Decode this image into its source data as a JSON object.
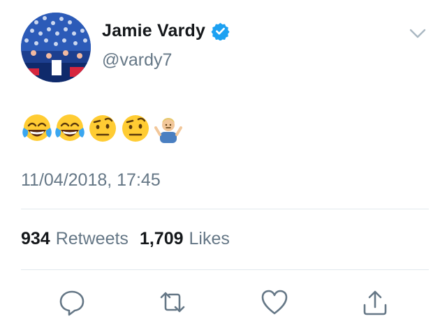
{
  "user": {
    "display_name": "Jamie Vardy",
    "handle": "@vardy7",
    "verified": true
  },
  "tweet": {
    "emojis": [
      "face-with-tears-of-joy",
      "face-with-tears-of-joy",
      "face-with-raised-eyebrow",
      "face-with-raised-eyebrow",
      "person-shrugging"
    ],
    "timestamp": "11/04/2018, 17:45"
  },
  "stats": {
    "retweets_count": "934",
    "retweets_label": "Retweets",
    "likes_count": "1,709",
    "likes_label": "Likes"
  },
  "actions": [
    "reply-icon",
    "retweet-icon",
    "like-icon",
    "share-icon"
  ],
  "colors": {
    "text": "#14171a",
    "secondary": "#657786",
    "verified": "#1da1f2",
    "divider": "#e1e8ed"
  }
}
